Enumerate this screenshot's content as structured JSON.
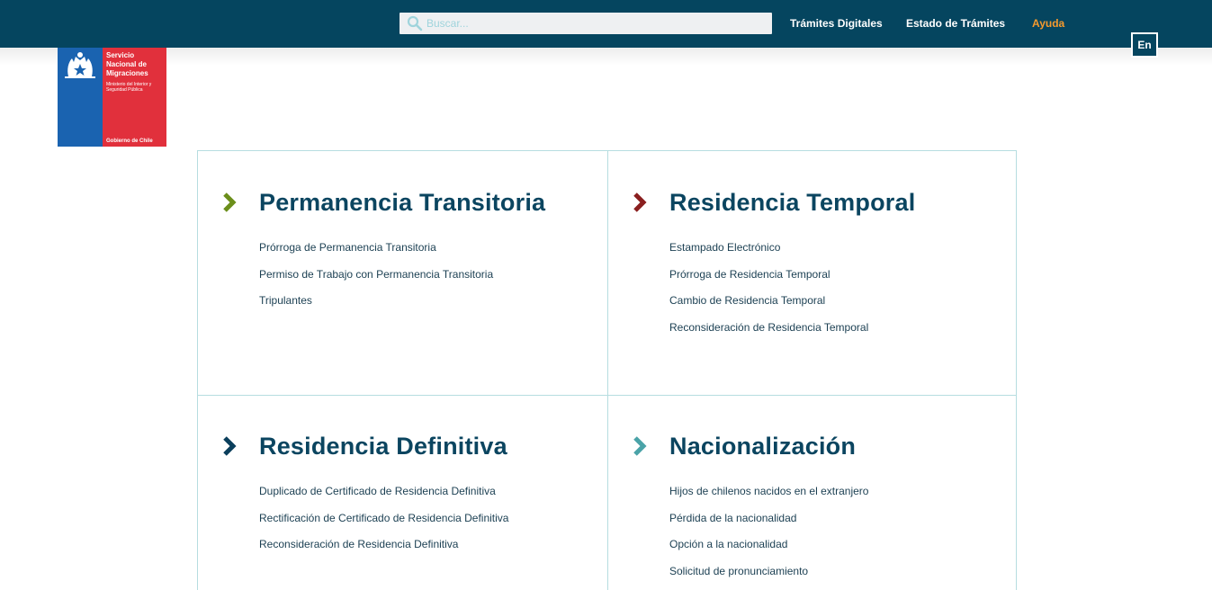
{
  "header": {
    "search": {
      "placeholder": "Buscar..."
    },
    "nav": [
      {
        "label": "Trámites Digitales"
      },
      {
        "label": "Estado de Trámites"
      },
      {
        "label": "Ayuda"
      }
    ],
    "lang_label": "En",
    "accent_color": "#f59a2e",
    "bar_color": "#05455f"
  },
  "logo": {
    "title": "Servicio Nacional de Migraciones",
    "subtitle": "Ministerio del Interior y Seguridad Pública",
    "footer": "Gobierno de Chile",
    "icon": "chile-crest-icon"
  },
  "sections": [
    {
      "title": "Permanencia Transitoria",
      "chevron_color": "#6b8e1a",
      "links": [
        "Prórroga de Permanencia Transitoria",
        "Permiso de Trabajo con Permanencia Transitoria",
        "Tripulantes"
      ]
    },
    {
      "title": "Residencia Temporal",
      "chevron_color": "#8a1f1f",
      "links": [
        "Estampado Electrónico",
        "Prórroga de Residencia Temporal",
        "Cambio de Residencia Temporal",
        "Reconsideración de Residencia Temporal"
      ]
    },
    {
      "title": "Residencia Definitiva",
      "chevron_color": "#0b3f5c",
      "links": [
        "Duplicado de Certificado de Residencia Definitiva",
        "Rectificación de Certificado de Residencia Definitiva",
        "Reconsideración de Residencia Definitiva"
      ]
    },
    {
      "title": "Nacionalización",
      "chevron_color": "#4aa3a8",
      "links": [
        "Hijos de chilenos nacidos en el extranjero",
        "Pérdida de la nacionalidad",
        "Opción a la nacionalidad",
        "Solicitud de pronunciamiento"
      ]
    }
  ]
}
